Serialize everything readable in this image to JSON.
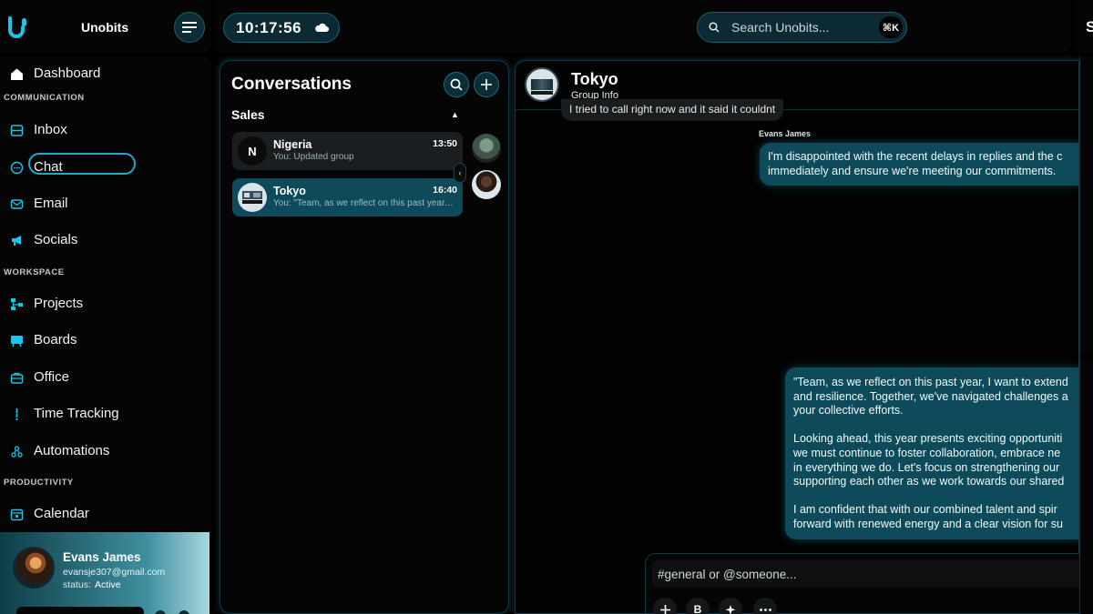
{
  "app": {
    "name": "Unobits"
  },
  "topbar": {
    "time": "10:17:56",
    "weather_icon": "cloud-icon",
    "search_placeholder": "Search Unobits...",
    "search_shortcut": "⌘K",
    "right_edge_text": "S"
  },
  "sidebar": {
    "dashboard": "Dashboard",
    "sections": [
      "COMMUNICATION",
      "WORKSPACE",
      "PRODUCTIVITY"
    ],
    "communication": [
      "Inbox",
      "Chat",
      "Email",
      "Socials"
    ],
    "workspace": [
      "Projects",
      "Boards",
      "Office",
      "Time Tracking",
      "Automations"
    ],
    "productivity": [
      "Calendar"
    ],
    "active": "Chat",
    "accent": "#1ea9c9"
  },
  "profile": {
    "name": "Evans James",
    "email": "evansje307@gmail.com",
    "status_label": "status:",
    "status_value": "Active"
  },
  "conversations": {
    "title": "Conversations",
    "group": "Sales",
    "items": [
      {
        "name": "Nigeria",
        "initial": "N",
        "time": "13:50",
        "preview": "You: Updated group"
      },
      {
        "name": "Tokyo",
        "time": "16:40",
        "preview": "You: \"Team, as we reflect on this past year, I want to extend"
      }
    ]
  },
  "chat": {
    "name": "Tokyo",
    "subtitle": "Group Info",
    "top_message": "I tried to call right now and it said it couldnt",
    "sender": "Evans James",
    "message1": [
      "I'm disappointed with the recent delays in replies and the c",
      "immediately and ensure we're meeting our commitments."
    ],
    "message2": [
      "\"Team, as we reflect on this past year, I want to extend",
      "and resilience. Together, we've navigated challenges a",
      "your collective efforts.",
      "",
      "Looking ahead, this year presents exciting opportuniti",
      "we must continue to foster collaboration, embrace ne",
      "in everything we do. Let's focus on strengthening our",
      "supporting each other as we work towards our shared",
      "",
      "I am confident that with our combined talent and spir",
      "forward with renewed energy and a clear vision for su"
    ],
    "composer_placeholder": "#general or @someone...",
    "composer_bold": "B",
    "bubble_color": "#0d4a5a"
  }
}
